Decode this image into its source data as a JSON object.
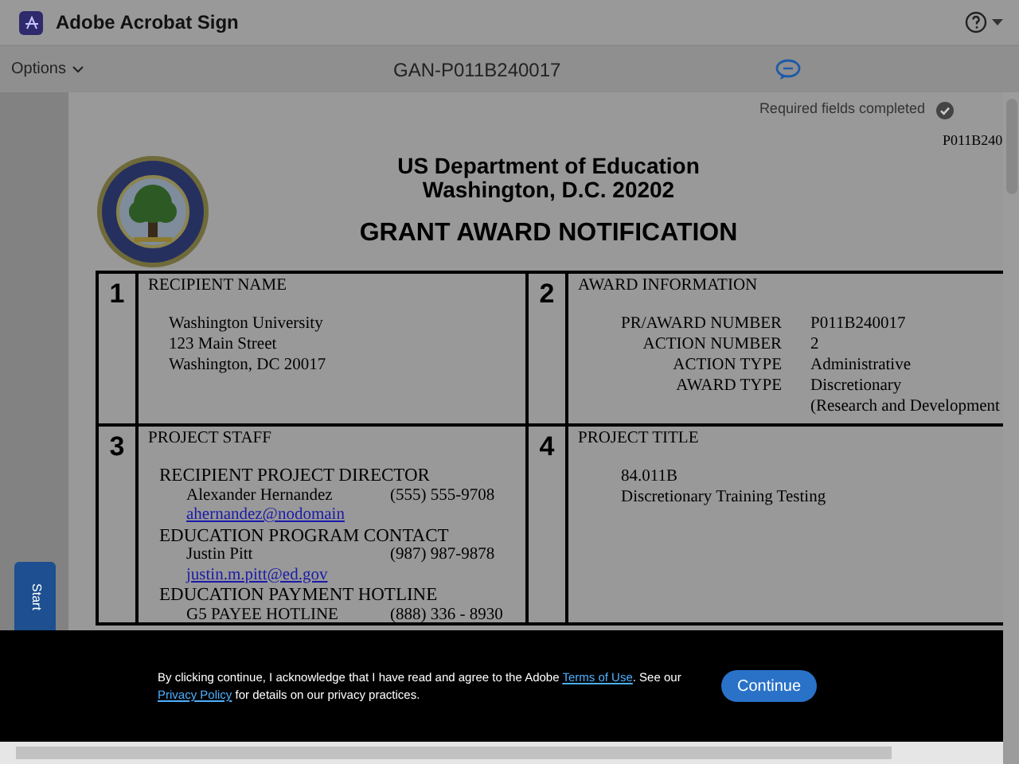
{
  "app": {
    "title": "Adobe Acrobat Sign"
  },
  "toolbar": {
    "options": "Options",
    "document_title": "GAN-P011B240017"
  },
  "status": {
    "text": "Required fields completed",
    "complete": true
  },
  "start_tab": {
    "label": "Start"
  },
  "document": {
    "header_lines": [
      "US Department of Education",
      "Washington, D.C. 20202"
    ],
    "title": "GRANT AWARD NOTIFICATION",
    "corner_ref": "P011B240",
    "sections": [
      {
        "kind": "lines",
        "number": "1",
        "heading": "RECIPIENT NAME",
        "lines": [
          "Washington University",
          "123 Main Street",
          "Washington, DC 20017"
        ]
      },
      {
        "kind": "fields",
        "number": "2",
        "heading": "AWARD INFORMATION",
        "fields": [
          {
            "label": "PR/AWARD NUMBER",
            "values": [
              "P011B240017"
            ]
          },
          {
            "label": "ACTION NUMBER",
            "values": [
              "2"
            ]
          },
          {
            "label": "ACTION TYPE",
            "values": [
              "Administrative"
            ]
          },
          {
            "label": "AWARD TYPE",
            "values": [
              "Discretionary",
              "(Research and Development"
            ]
          }
        ]
      },
      {
        "kind": "contacts",
        "number": "3",
        "heading": "PROJECT STAFF",
        "groups": [
          {
            "title": "RECIPIENT PROJECT DIRECTOR",
            "entries": [
              {
                "name": "Alexander Hernandez",
                "phone": "(555) 555-9708",
                "email": "ahernandez@nodomain"
              }
            ]
          },
          {
            "title": "EDUCATION PROGRAM CONTACT",
            "entries": [
              {
                "name": "Justin Pitt",
                "phone": "(987) 987-9878",
                "email": "justin.m.pitt@ed.gov"
              }
            ]
          },
          {
            "title": "EDUCATION PAYMENT HOTLINE",
            "entries": [
              {
                "name": "G5 PAYEE HOTLINE",
                "phone": "(888) 336 - 8930"
              }
            ]
          }
        ]
      },
      {
        "kind": "lines",
        "number": "4",
        "heading": "PROJECT TITLE",
        "lines": [
          "84.011B",
          "Discretionary Training Testing"
        ]
      }
    ]
  },
  "consent": {
    "parts": [
      {
        "kind": "text",
        "text": "By clicking continue, I acknowledge that I have read and agree to the Adobe "
      },
      {
        "kind": "link",
        "text": "Terms of Use"
      },
      {
        "kind": "text",
        "text": ". See our "
      },
      {
        "kind": "link",
        "text": "Privacy Policy"
      },
      {
        "kind": "text",
        "text": " for details on our privacy practices."
      }
    ],
    "button": "Continue"
  }
}
